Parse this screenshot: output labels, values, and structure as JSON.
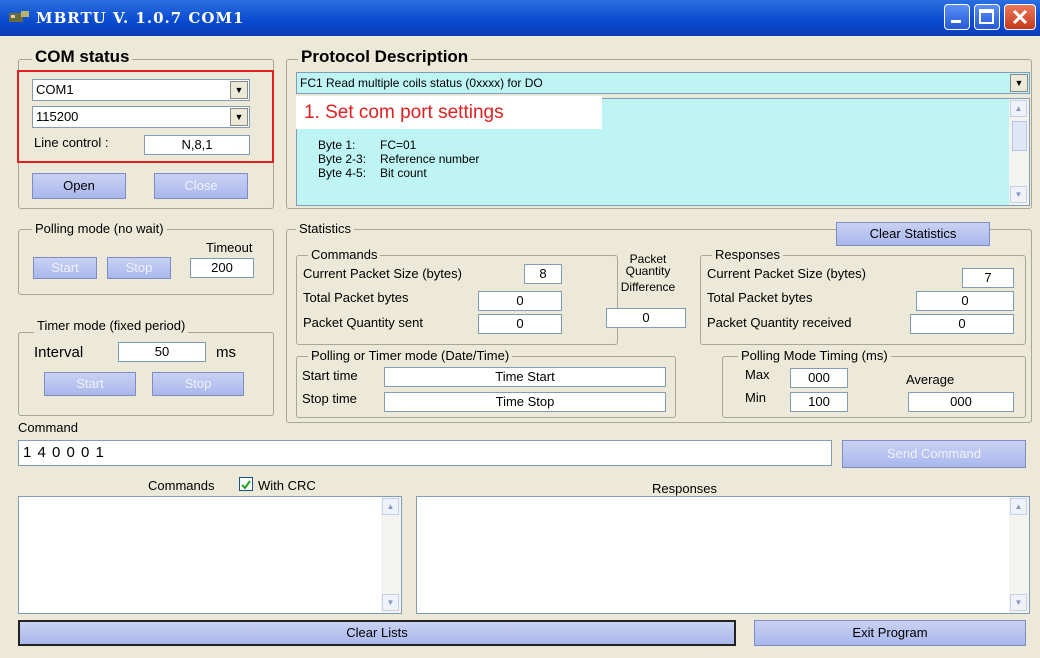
{
  "window": {
    "title": "MBRTU  V. 1.0.7  COM1"
  },
  "com_status": {
    "title": "COM status",
    "port": "COM1",
    "baud": "115200",
    "line_control_label": "Line control :",
    "line_control_value": "N,8,1",
    "open_label": "Open",
    "close_label": "Close"
  },
  "annotation": {
    "text": "1. Set com port settings"
  },
  "protocol": {
    "title": "Protocol Description",
    "selected": "FC1  Read multiple coils status (0xxxx)  for DO",
    "lines": [
      {
        "k": "Byte 1:",
        "v": "FC=01"
      },
      {
        "k": "Byte 2-3:",
        "v": "Reference number"
      },
      {
        "k": "Byte 4-5:",
        "v": "Bit count"
      }
    ]
  },
  "polling": {
    "title": "Polling mode (no wait)",
    "timeout_label": "Timeout",
    "timeout_value": "200",
    "start_label": "Start",
    "stop_label": "Stop"
  },
  "timer": {
    "title": "Timer mode (fixed period)",
    "interval_label": "Interval",
    "interval_value": "50",
    "unit": "ms",
    "start_label": "Start",
    "stop_label": "Stop"
  },
  "statistics": {
    "title": "Statistics",
    "clear_label": "Clear Statistics",
    "commands": {
      "title": "Commands",
      "current_size_label": "Current Packet Size (bytes)",
      "current_size": "8",
      "total_bytes_label": "Total Packet bytes",
      "total_bytes": "0",
      "qty_sent_label": "Packet Quantity sent",
      "qty_sent": "0"
    },
    "packet_qty_label": "Packet Quantity Difference",
    "packet_qty_lines": [
      "Packet",
      "Quantity",
      "Difference"
    ],
    "packet_qty_value": "0",
    "responses": {
      "title": "Responses",
      "current_size_label": "Current Packet Size (bytes)",
      "current_size": "7",
      "total_bytes_label": "Total Packet bytes",
      "total_bytes": "0",
      "qty_recv_label": "Packet Quantity received",
      "qty_recv": "0"
    },
    "datetime": {
      "title": "Polling  or Timer mode  (Date/Time)",
      "start_label": "Start time",
      "start_value": "Time Start",
      "stop_label": "Stop time",
      "stop_value": "Time Stop"
    },
    "timing": {
      "title": "Polling Mode Timing (ms)",
      "max_label": "Max",
      "max_value": "000",
      "min_label": "Min",
      "min_value": "100",
      "avg_label": "Average",
      "avg_value": "000"
    }
  },
  "command": {
    "label": "Command",
    "value": "1 4 0 0 0 1",
    "send_label": "Send Command"
  },
  "lists": {
    "commands_label": "Commands",
    "with_crc_label": "With CRC",
    "with_crc_checked": true,
    "responses_label": "Responses",
    "clear_label": "Clear Lists",
    "exit_label": "Exit Program"
  },
  "colors": {
    "titlebar": "#0a4ad0",
    "window_bg": "#ece9d8",
    "protocol_bg": "#bff4f4",
    "annotation_border": "#e02020",
    "button": "#b4c1ee"
  }
}
